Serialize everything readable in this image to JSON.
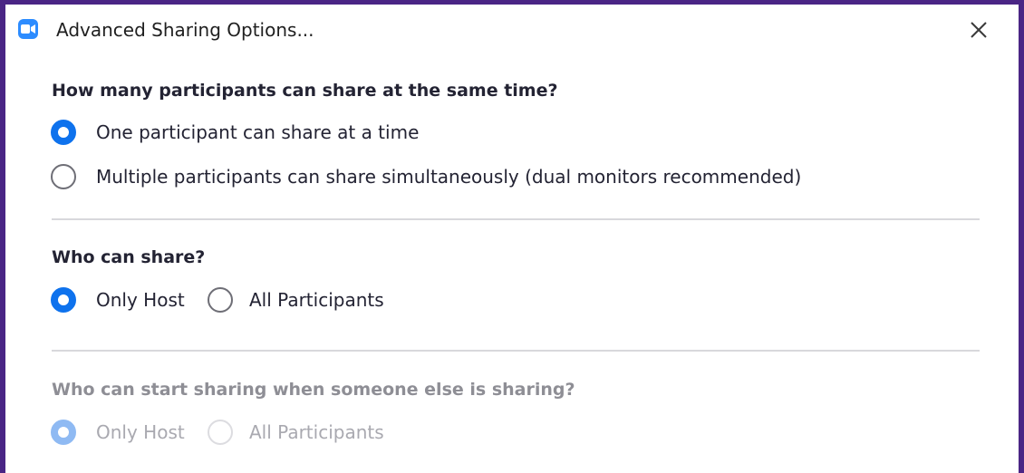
{
  "window": {
    "title": "Advanced Sharing Options...",
    "app_icon": "zoom-video-camera-icon",
    "close_icon": "close-icon",
    "accent_color": "#0e72ed",
    "background_color": "#4a2585"
  },
  "sections": [
    {
      "heading": "How many participants can share at the same time?",
      "enabled": true,
      "options": [
        {
          "label": "One participant can share at a time",
          "selected": true
        },
        {
          "label": "Multiple participants can share simultaneously (dual monitors recommended)",
          "selected": false
        }
      ]
    },
    {
      "heading": "Who can share?",
      "enabled": true,
      "options": [
        {
          "label": "Only Host",
          "selected": true
        },
        {
          "label": "All Participants",
          "selected": false
        }
      ]
    },
    {
      "heading": "Who can start sharing when someone else is sharing?",
      "enabled": false,
      "options": [
        {
          "label": "Only Host",
          "selected": true
        },
        {
          "label": "All Participants",
          "selected": false
        }
      ]
    }
  ]
}
